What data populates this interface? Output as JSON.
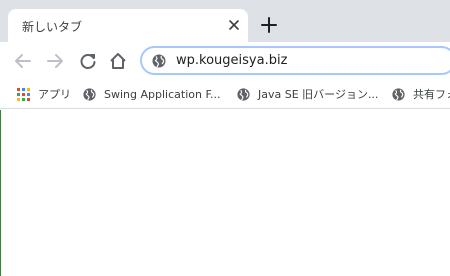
{
  "tab": {
    "title": "新しいタブ",
    "close_icon": "close-icon"
  },
  "toolbar": {
    "back_icon": "back-arrow-icon",
    "forward_icon": "forward-arrow-icon",
    "reload_icon": "reload-icon",
    "home_icon": "home-icon"
  },
  "omnibox": {
    "url": "wp.kougeisya.biz",
    "site_icon": "globe-icon"
  },
  "bookmarks": [
    {
      "label": "アプリ",
      "icon": "apps-grid-icon"
    },
    {
      "label": "Swing Application F...",
      "icon": "globe-icon"
    },
    {
      "label": "Java SE 旧バージョン...",
      "icon": "globe-icon"
    },
    {
      "label": "共有フォ",
      "icon": "globe-icon"
    }
  ],
  "colors": {
    "tabstrip": "#dee1e6",
    "omnibox_border": "#a8c7fa",
    "icon": "#5f6368",
    "disabled_icon": "#bdc1c6"
  }
}
